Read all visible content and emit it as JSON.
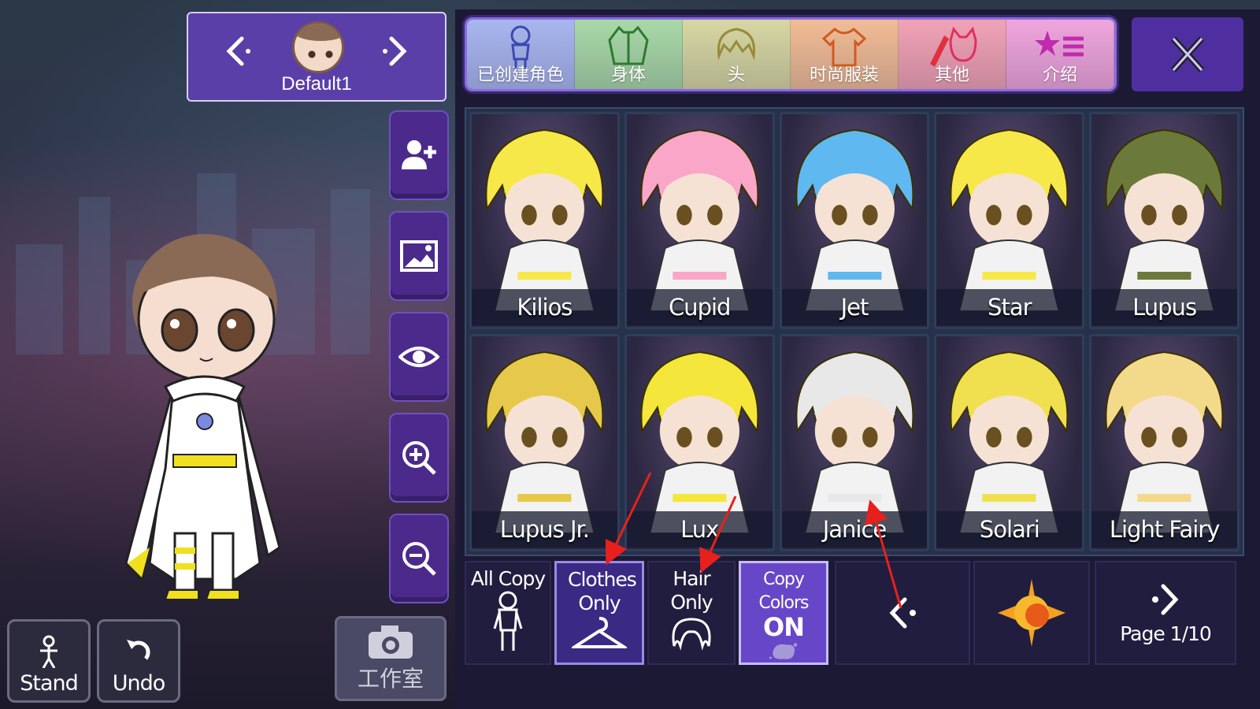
{
  "character_selector": {
    "name": "Default1",
    "prev_icon": "chevron-left-icon",
    "next_icon": "chevron-right-icon"
  },
  "side_tools": [
    {
      "name": "add-character-button",
      "icon": "add-user-icon"
    },
    {
      "name": "background-button",
      "icon": "image-icon"
    },
    {
      "name": "visibility-button",
      "icon": "eye-icon"
    },
    {
      "name": "zoom-in-button",
      "icon": "zoom-in-icon"
    },
    {
      "name": "zoom-out-button",
      "icon": "zoom-out-icon"
    }
  ],
  "bottom_left": {
    "stand_label": "Stand",
    "undo_label": "Undo",
    "studio_label": "工作室"
  },
  "tabs": [
    {
      "label": "已创建角色",
      "icon": "preset-person-icon",
      "color": "#a9b7f0"
    },
    {
      "label": "身体",
      "icon": "body-icon",
      "color": "#a9d9a8"
    },
    {
      "label": "头",
      "icon": "hair-icon",
      "color": "#d7d8a3"
    },
    {
      "label": "时尚服装",
      "icon": "shirt-icon",
      "color": "#f2bd96"
    },
    {
      "label": "其他",
      "icon": "sword-cat-icon",
      "color": "#f2a3b6"
    },
    {
      "label": "介绍",
      "icon": "star-list-icon",
      "color": "#f0a6dd"
    }
  ],
  "presets": [
    {
      "name": "Kilios",
      "accent": "#f7e84a"
    },
    {
      "name": "Cupid",
      "accent": "#f9a6c8"
    },
    {
      "name": "Jet",
      "accent": "#5fb8f0"
    },
    {
      "name": "Star",
      "accent": "#f7e84a"
    },
    {
      "name": "Lupus",
      "accent": "#6b7a3a"
    },
    {
      "name": "Lupus Jr.",
      "accent": "#e6c94a"
    },
    {
      "name": "Lux",
      "accent": "#f4e63a"
    },
    {
      "name": "Janice",
      "accent": "#e8e8e8"
    },
    {
      "name": "Solari",
      "accent": "#f0e050"
    },
    {
      "name": "Light Fairy",
      "accent": "#f3d98a"
    }
  ],
  "copy_options": {
    "all_copy": "All Copy",
    "clothes_only": "Clothes Only",
    "hair_only": "Hair Only",
    "copy_colors": "Copy Colors",
    "copy_colors_state": "ON"
  },
  "pagination": {
    "page_label": "Page 1/10"
  },
  "annotations": {
    "arrow_color": "#e8201c"
  }
}
